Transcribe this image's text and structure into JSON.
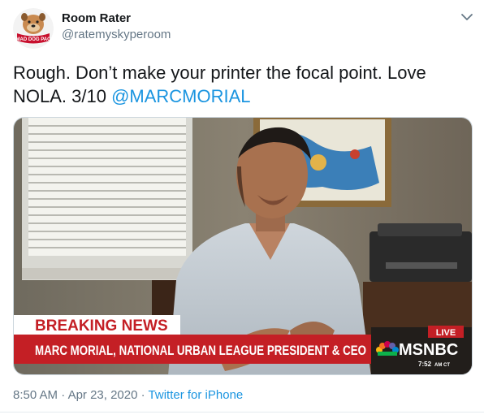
{
  "author": {
    "name": "Room Rater",
    "handle": "@ratemyskyperoom",
    "avatar_text": "MAD DOG PAC"
  },
  "tweet": {
    "text": "Rough. Don’t make your printer the focal point. Love NOLA. 3/10 ",
    "mention": "@MARCMORIAL"
  },
  "media": {
    "breaking_label": "BREAKING NEWS",
    "lower_third": "MARC MORIAL, NATIONAL URBAN LEAGUE PRESIDENT & CEO",
    "live_label": "LIVE",
    "network": "MSNBC",
    "time": "7:52",
    "time_zone": "AM CT"
  },
  "meta": {
    "time": "8:50 AM",
    "separator": "·",
    "date": "Apr 23, 2020",
    "source": "Twitter for iPhone"
  },
  "colors": {
    "link": "#1b95e0",
    "secondary_text": "#657786",
    "breaking_red": "#c41f25"
  }
}
